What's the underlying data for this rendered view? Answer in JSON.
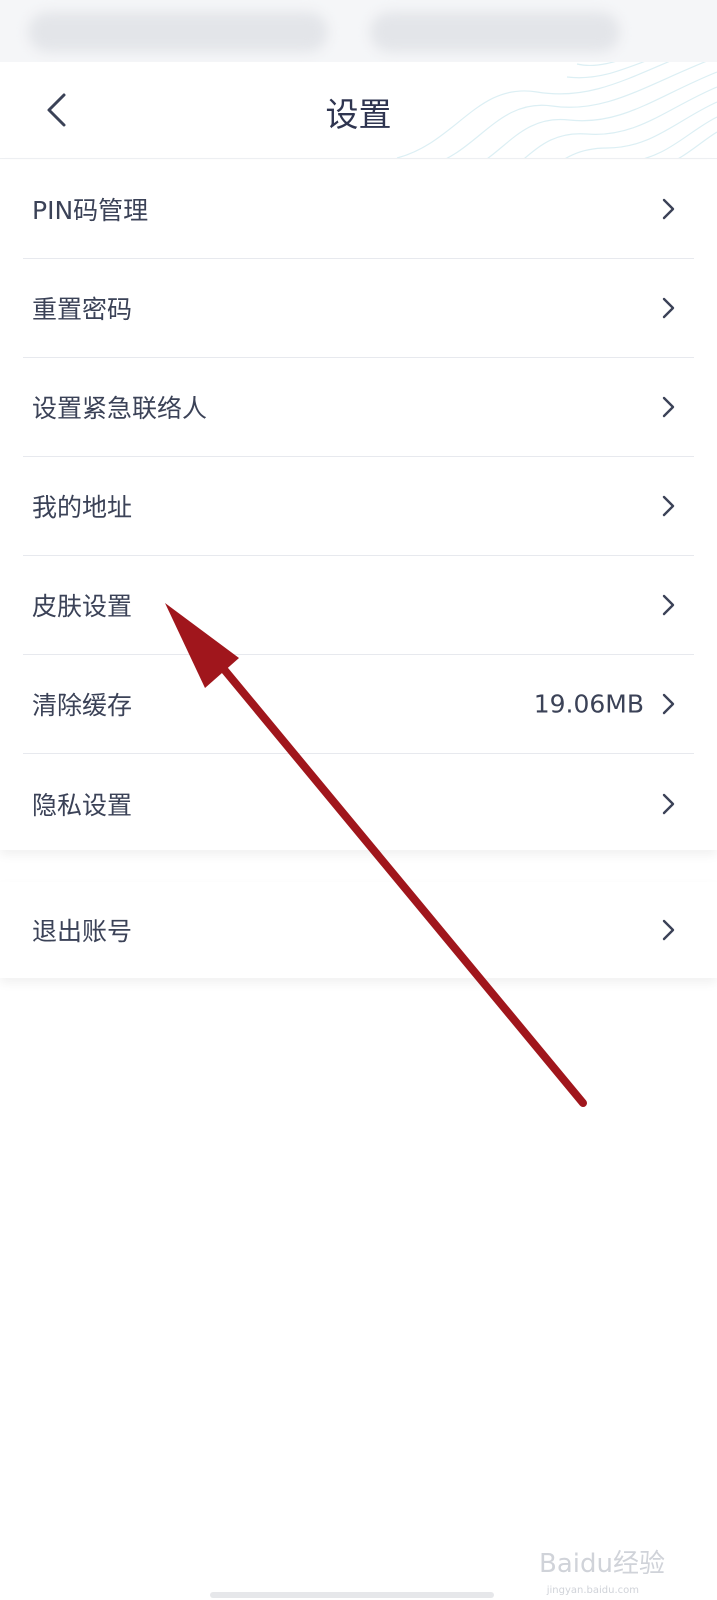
{
  "header": {
    "title": "设置"
  },
  "settings_group": {
    "items": [
      {
        "label": "PIN码管理",
        "value": ""
      },
      {
        "label": "重置密码",
        "value": ""
      },
      {
        "label": "设置紧急联络人",
        "value": ""
      },
      {
        "label": "我的地址",
        "value": ""
      },
      {
        "label": "皮肤设置",
        "value": ""
      },
      {
        "label": "清除缓存",
        "value": "19.06MB"
      },
      {
        "label": "隐私设置",
        "value": ""
      }
    ]
  },
  "account_group": {
    "logout_label": "退出账号"
  },
  "watermark": {
    "brand": "Baidu经验",
    "site": "jingyan.baidu.com"
  },
  "colors": {
    "text": "#3b4257",
    "annotation_arrow": "#a0161c",
    "divider": "#e7e9ee"
  },
  "icons": {
    "back": "chevron-left-icon",
    "row": "chevron-right-icon"
  }
}
